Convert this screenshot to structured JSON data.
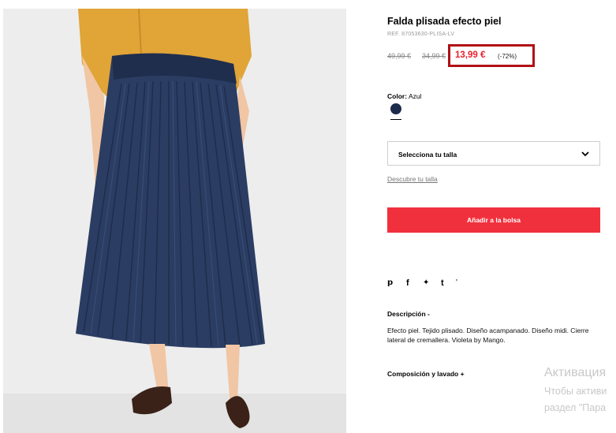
{
  "product": {
    "title": "Falda plisada efecto piel",
    "ref": "REF. 87053630-PLISA-LV",
    "old_price_1": "49,99 €",
    "old_price_2": "34,99 €",
    "price": "13,99 €",
    "discount": "(-72%)",
    "accent_color": "#e8212e"
  },
  "color": {
    "label": "Color:",
    "value": "Azul",
    "swatch_hex": "#1c2a4c"
  },
  "size": {
    "select_label": "Selecciona tu talla",
    "guide_link": "Descubre tu talla"
  },
  "cart": {
    "add_label": "Añadir a la bolsa",
    "button_color": "#f0313d"
  },
  "share": {
    "pinterest": "𝗽",
    "facebook": "f",
    "twitter": "✦",
    "tumblr": "t",
    "more": "'"
  },
  "description": {
    "title": "Descripción  -",
    "text": "Efecto piel. Tejido plisado. Diseño acampanado. Diseño midi. Cierre lateral de cremallera. Violeta by Mango."
  },
  "composition": {
    "title": "Composición y lavado  +"
  },
  "watermark": {
    "line1": "Активация",
    "line2": "Чтобы активи",
    "line3": "раздел \"Пара"
  }
}
